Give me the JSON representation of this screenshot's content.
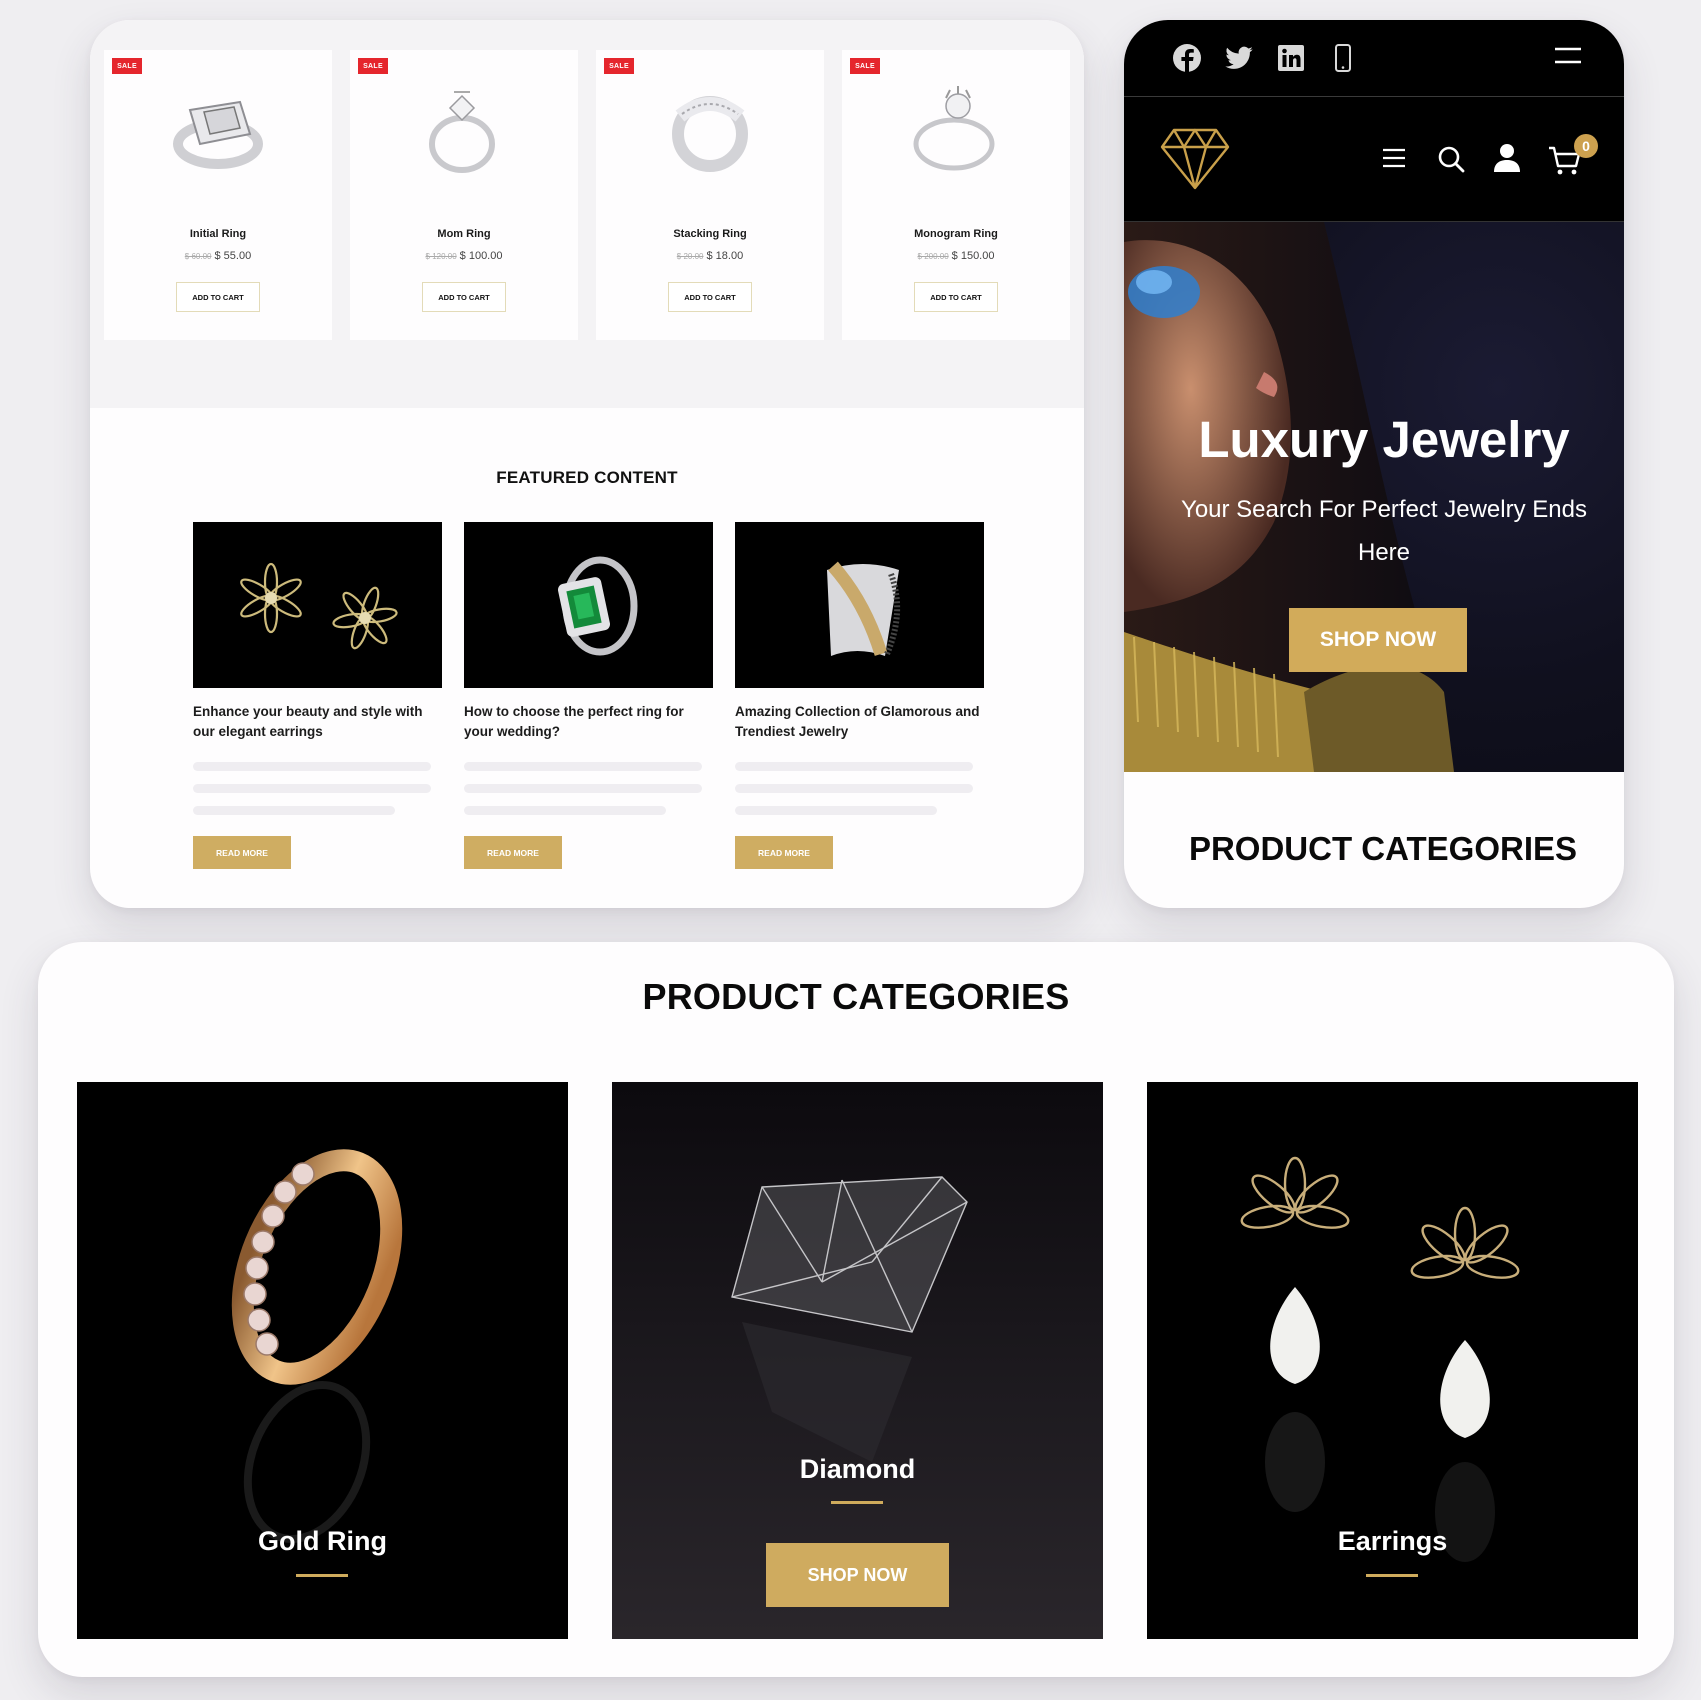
{
  "products": [
    {
      "badge": "SALE",
      "name": "Initial Ring",
      "old_price": "$ 60.00",
      "price": "$ 55.00",
      "cta": "ADD TO CART"
    },
    {
      "badge": "SALE",
      "name": "Mom Ring",
      "old_price": "$ 120.00",
      "price": "$ 100.00",
      "cta": "ADD TO CART"
    },
    {
      "badge": "SALE",
      "name": "Stacking Ring",
      "old_price": "$ 20.00",
      "price": "$ 18.00",
      "cta": "ADD TO CART"
    },
    {
      "badge": "SALE",
      "name": "Monogram Ring",
      "old_price": "$ 200.00",
      "price": "$ 150.00",
      "cta": "ADD TO CART"
    }
  ],
  "featured": {
    "title": "FEATURED CONTENT",
    "posts": [
      {
        "title": "Enhance your beauty and style with our elegant earrings",
        "image": "flower-earrings",
        "cta": "READ MORE"
      },
      {
        "title": "How to choose the perfect ring for your wedding?",
        "image": "emerald-ring",
        "cta": "READ MORE"
      },
      {
        "title": "Amazing Collection of Glamorous and Trendiest Jewelry",
        "image": "diamond-cuff-bracelet",
        "cta": "READ MORE"
      }
    ]
  },
  "mobile": {
    "social_icons": [
      "facebook-icon",
      "twitter-icon",
      "linkedin-icon",
      "phone-icon"
    ],
    "nav_icons": [
      "menu-icon",
      "search-icon",
      "user-icon",
      "cart-icon"
    ],
    "cart_count": "0",
    "hero": {
      "title": "Luxury Jewelry",
      "subtitle": "Your Search For Perfect Jewelry Ends Here",
      "cta": "SHOP NOW"
    },
    "section_title": "PRODUCT CATEGORIES"
  },
  "categories": {
    "title": "PRODUCT CATEGORIES",
    "items": [
      {
        "label": "Gold Ring",
        "image": "gold-diamond-ring"
      },
      {
        "label": "Diamond",
        "image": "loose-diamond",
        "cta": "SHOP NOW"
      },
      {
        "label": "Earrings",
        "image": "pearl-drop-earrings"
      }
    ]
  },
  "colors": {
    "accent_gold": "#cfab5c",
    "sale_red": "#e5262d",
    "header_black": "#000000"
  }
}
